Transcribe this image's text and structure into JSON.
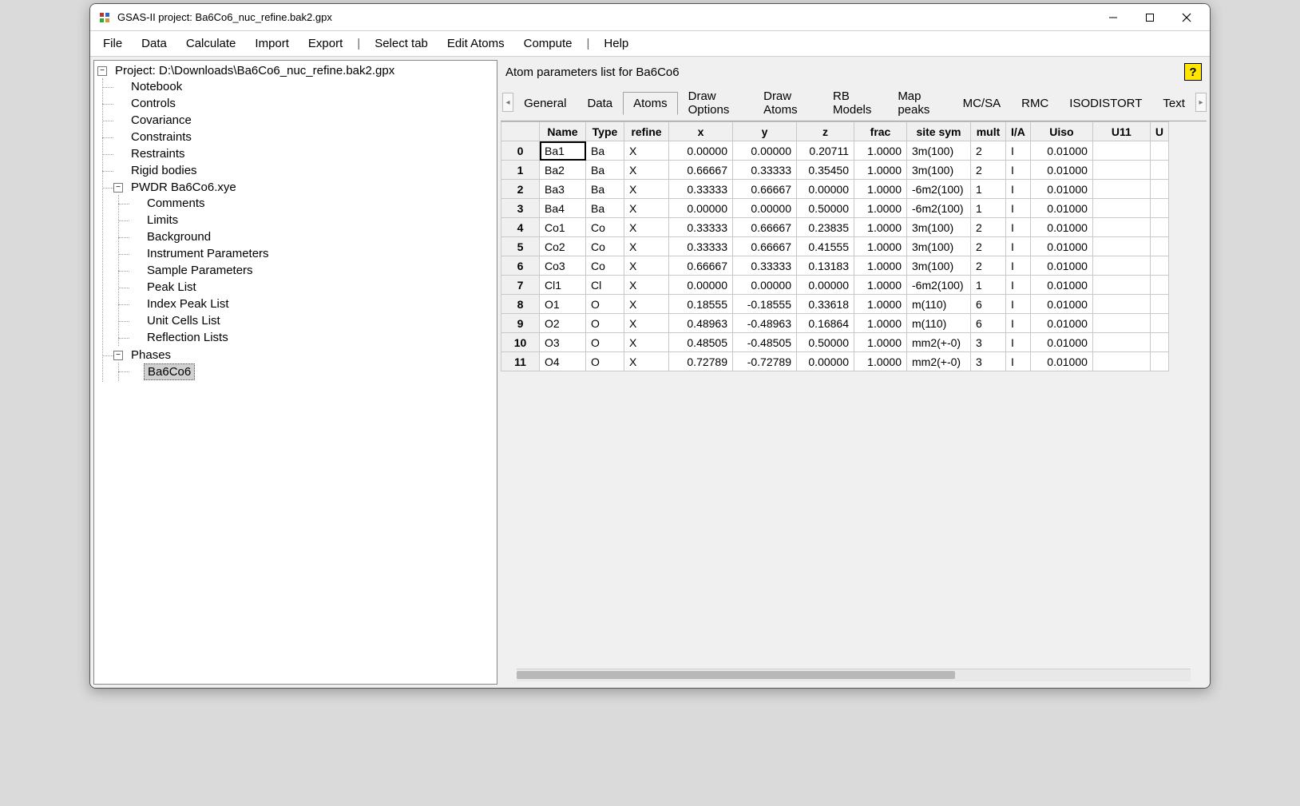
{
  "window": {
    "title": "GSAS-II project: Ba6Co6_nuc_refine.bak2.gpx"
  },
  "menu": {
    "items": [
      "File",
      "Data",
      "Calculate",
      "Import",
      "Export",
      "|",
      "Select tab",
      "Edit Atoms",
      "Compute",
      "|",
      "Help"
    ]
  },
  "tree": {
    "root": "Project: D:\\Downloads\\Ba6Co6_nuc_refine.bak2.gpx",
    "top": [
      "Notebook",
      "Controls",
      "Covariance",
      "Constraints",
      "Restraints",
      "Rigid bodies"
    ],
    "pwdr": {
      "label": "PWDR Ba6Co6.xye",
      "children": [
        "Comments",
        "Limits",
        "Background",
        "Instrument Parameters",
        "Sample Parameters",
        "Peak List",
        "Index Peak List",
        "Unit Cells List",
        "Reflection Lists"
      ]
    },
    "phases": {
      "label": "Phases",
      "children": [
        "Ba6Co6"
      ]
    }
  },
  "panel": {
    "title": "Atom parameters list for Ba6Co6",
    "help": "?"
  },
  "tabs": {
    "items": [
      "General",
      "Data",
      "Atoms",
      "Draw Options",
      "Draw Atoms",
      "RB Models",
      "Map peaks",
      "MC/SA",
      "RMC",
      "ISODISTORT",
      "Text"
    ],
    "active_index": 2
  },
  "grid": {
    "columns": [
      "Name",
      "Type",
      "refine",
      "x",
      "y",
      "z",
      "frac",
      "site sym",
      "mult",
      "I/A",
      "Uiso",
      "U11",
      "U"
    ],
    "rows": [
      {
        "idx": "0",
        "Name": "Ba1",
        "Type": "Ba",
        "refine": "X",
        "x": "0.00000",
        "y": "0.00000",
        "z": "0.20711",
        "frac": "1.0000",
        "site_sym": "3m(100)",
        "mult": "2",
        "IA": "I",
        "Uiso": "0.01000",
        "U11": ""
      },
      {
        "idx": "1",
        "Name": "Ba2",
        "Type": "Ba",
        "refine": "X",
        "x": "0.66667",
        "y": "0.33333",
        "z": "0.35450",
        "frac": "1.0000",
        "site_sym": "3m(100)",
        "mult": "2",
        "IA": "I",
        "Uiso": "0.01000",
        "U11": ""
      },
      {
        "idx": "2",
        "Name": "Ba3",
        "Type": "Ba",
        "refine": "X",
        "x": "0.33333",
        "y": "0.66667",
        "z": "0.00000",
        "frac": "1.0000",
        "site_sym": "-6m2(100)",
        "mult": "1",
        "IA": "I",
        "Uiso": "0.01000",
        "U11": ""
      },
      {
        "idx": "3",
        "Name": "Ba4",
        "Type": "Ba",
        "refine": "X",
        "x": "0.00000",
        "y": "0.00000",
        "z": "0.50000",
        "frac": "1.0000",
        "site_sym": "-6m2(100)",
        "mult": "1",
        "IA": "I",
        "Uiso": "0.01000",
        "U11": ""
      },
      {
        "idx": "4",
        "Name": "Co1",
        "Type": "Co",
        "refine": "X",
        "x": "0.33333",
        "y": "0.66667",
        "z": "0.23835",
        "frac": "1.0000",
        "site_sym": "3m(100)",
        "mult": "2",
        "IA": "I",
        "Uiso": "0.01000",
        "U11": ""
      },
      {
        "idx": "5",
        "Name": "Co2",
        "Type": "Co",
        "refine": "X",
        "x": "0.33333",
        "y": "0.66667",
        "z": "0.41555",
        "frac": "1.0000",
        "site_sym": "3m(100)",
        "mult": "2",
        "IA": "I",
        "Uiso": "0.01000",
        "U11": ""
      },
      {
        "idx": "6",
        "Name": "Co3",
        "Type": "Co",
        "refine": "X",
        "x": "0.66667",
        "y": "0.33333",
        "z": "0.13183",
        "frac": "1.0000",
        "site_sym": "3m(100)",
        "mult": "2",
        "IA": "I",
        "Uiso": "0.01000",
        "U11": ""
      },
      {
        "idx": "7",
        "Name": "Cl1",
        "Type": "Cl",
        "refine": "X",
        "x": "0.00000",
        "y": "0.00000",
        "z": "0.00000",
        "frac": "1.0000",
        "site_sym": "-6m2(100)",
        "mult": "1",
        "IA": "I",
        "Uiso": "0.01000",
        "U11": ""
      },
      {
        "idx": "8",
        "Name": "O1",
        "Type": "O",
        "refine": "X",
        "x": "0.18555",
        "y": "-0.18555",
        "z": "0.33618",
        "frac": "1.0000",
        "site_sym": "m(110)",
        "mult": "6",
        "IA": "I",
        "Uiso": "0.01000",
        "U11": ""
      },
      {
        "idx": "9",
        "Name": "O2",
        "Type": "O",
        "refine": "X",
        "x": "0.48963",
        "y": "-0.48963",
        "z": "0.16864",
        "frac": "1.0000",
        "site_sym": "m(110)",
        "mult": "6",
        "IA": "I",
        "Uiso": "0.01000",
        "U11": ""
      },
      {
        "idx": "10",
        "Name": "O3",
        "Type": "O",
        "refine": "X",
        "x": "0.48505",
        "y": "-0.48505",
        "z": "0.50000",
        "frac": "1.0000",
        "site_sym": "mm2(+-0)",
        "mult": "3",
        "IA": "I",
        "Uiso": "0.01000",
        "U11": ""
      },
      {
        "idx": "11",
        "Name": "O4",
        "Type": "O",
        "refine": "X",
        "x": "0.72789",
        "y": "-0.72789",
        "z": "0.00000",
        "frac": "1.0000",
        "site_sym": "mm2(+-0)",
        "mult": "3",
        "IA": "I",
        "Uiso": "0.01000",
        "U11": ""
      }
    ]
  }
}
